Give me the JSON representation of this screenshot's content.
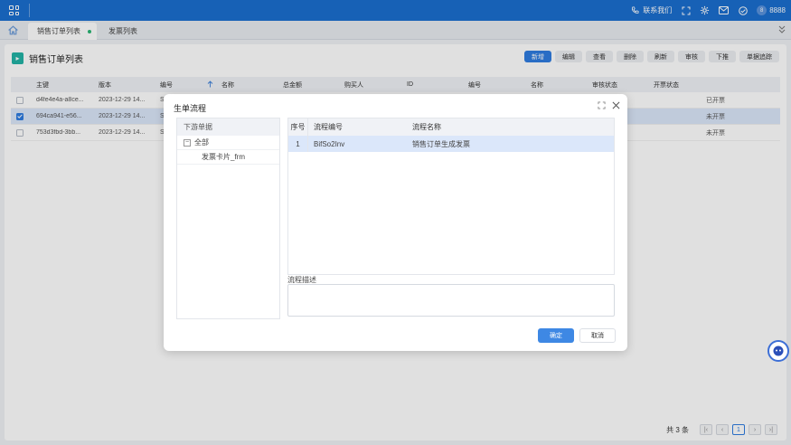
{
  "topbar": {
    "contact_label": "联系我们",
    "user_avatar": "8",
    "user_name": "8888",
    "brand_color": "#1b6fd0"
  },
  "tabs": [
    {
      "label": "销售订单列表",
      "active": true
    },
    {
      "label": "发票列表",
      "active": false
    }
  ],
  "page": {
    "title": "销售订单列表",
    "toolbar": [
      "新增",
      "编辑",
      "查看",
      "删除",
      "刷新",
      "审核",
      "下推",
      "单据追踪"
    ]
  },
  "table": {
    "columns": [
      "主键",
      "版本",
      "编号",
      "名称",
      "总金额",
      "购买人",
      "ID",
      "编号",
      "名称",
      "审核状态",
      "开票状态"
    ],
    "rows": [
      {
        "id": "d4fe4e4a-a8ce...",
        "version": "2023-12-29 14...",
        "code": "S",
        "checked": false,
        "invoice": "已开票"
      },
      {
        "id": "694ca941-e56...",
        "version": "2023-12-29 14...",
        "code": "S",
        "checked": true,
        "invoice": "未开票"
      },
      {
        "id": "753d3fbd-3bb...",
        "version": "2023-12-29 14...",
        "code": "S",
        "checked": false,
        "invoice": "未开票"
      }
    ]
  },
  "pager": {
    "total": "共 3 条",
    "current": "1"
  },
  "dialog": {
    "title": "生单流程",
    "left_header": "下游单据",
    "tree_root": "全部",
    "tree_child": "发票卡片_frm",
    "grid_headers": [
      "序号",
      "流程编号",
      "流程名称"
    ],
    "grid_row": {
      "seq": "1",
      "code": "BifSo2Inv",
      "name": "销售订单生成发票"
    },
    "desc_label": "流程描述",
    "ok_label": "确定",
    "cancel_label": "取消"
  }
}
